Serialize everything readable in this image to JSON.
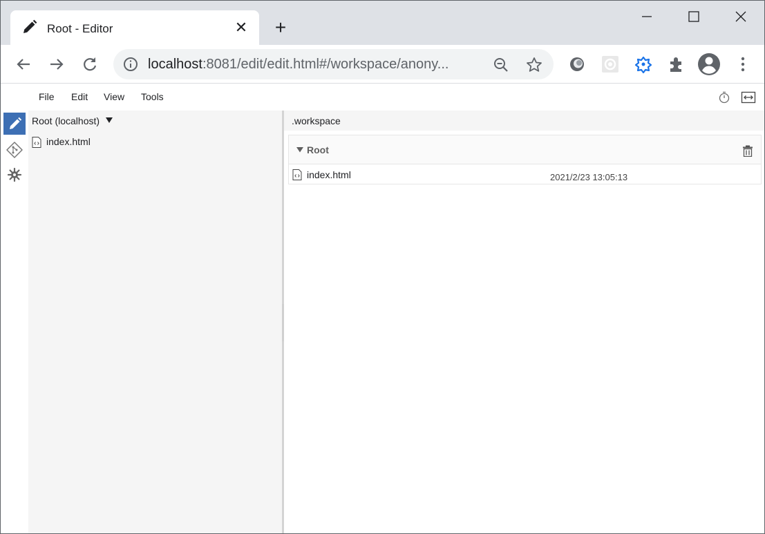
{
  "browser": {
    "tab_title": "Root - Editor",
    "new_tab_symbol": "+",
    "close_symbol": "✕",
    "url_host": "localhost",
    "url_rest": ":8081/edit/edit.html#/workspace/anony...",
    "icons": [
      "pencil-icon",
      "back-icon",
      "forward-icon",
      "reload-icon",
      "info-icon",
      "zoom-out-icon",
      "star-icon",
      "extension-1-icon",
      "extension-2-icon",
      "extension-3-icon",
      "puzzle-icon",
      "profile-icon",
      "kebab-menu-icon",
      "minimize-icon",
      "maximize-icon",
      "window-close-icon"
    ]
  },
  "app": {
    "menu": {
      "file": "File",
      "edit": "Edit",
      "view": "View",
      "tools": "Tools"
    },
    "sidebar": {
      "root_label": "Root (localhost)",
      "files": [
        {
          "label": "index.html"
        }
      ]
    },
    "main": {
      "breadcrumb": ".workspace",
      "panel_title": "Root",
      "rows": [
        {
          "name": "index.html",
          "modified": "2021/2/23 13:05:13"
        }
      ]
    }
  },
  "colors": {
    "accent": "#3d6fb4",
    "tabstrip": "#dee1e6",
    "sidebar_bg": "#f5f5f5"
  }
}
